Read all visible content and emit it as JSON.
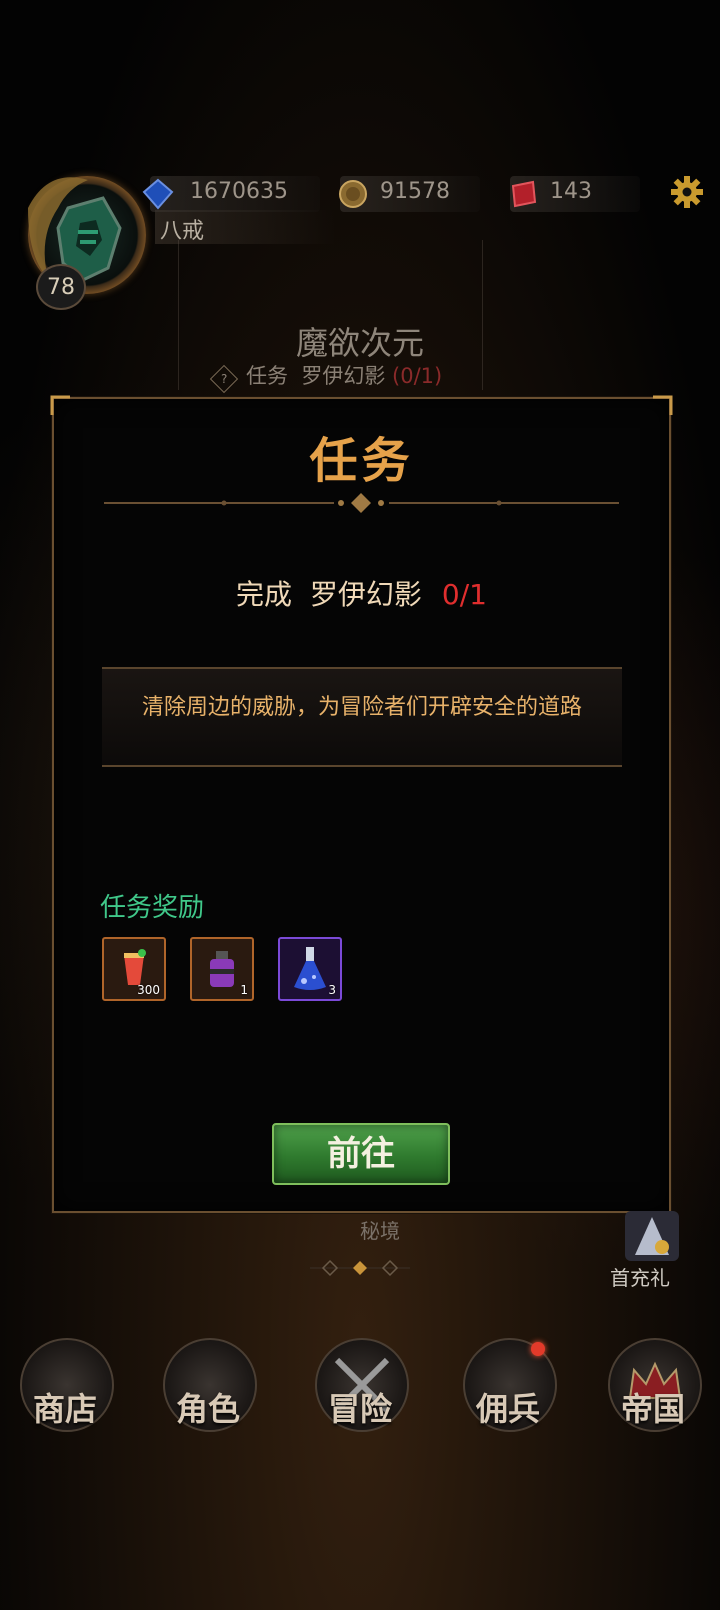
{
  "player": {
    "name": "八戒",
    "level": "78"
  },
  "resources": [
    {
      "name": "diamond-currency",
      "value": "1670635"
    },
    {
      "name": "gold-coin",
      "value": "91578"
    },
    {
      "name": "red-crystal",
      "value": "143"
    }
  ],
  "zone": {
    "title": "魔欲次元",
    "quest_prefix": "任务",
    "quest_target": "罗伊幻影",
    "quest_progress": "(0/1)",
    "hint_icon": "?"
  },
  "dialog": {
    "title": "任务",
    "objective_verb": "完成",
    "objective_target": "罗伊幻影",
    "objective_progress": "0/1",
    "description": "清除周边的威胁，为冒险者们开辟安全的道路",
    "reward_label": "任务奖励",
    "rewards": [
      {
        "icon": "cocktail-drink-icon",
        "qty": "300"
      },
      {
        "icon": "purple-jar-icon",
        "qty": "1"
      },
      {
        "icon": "blue-potion-flask-icon",
        "qty": "3"
      }
    ],
    "go_button": "前往"
  },
  "secret_realm_label": "秘境",
  "first_recharge_label": "首充礼",
  "nav": [
    {
      "label": "商店",
      "icon": "castle-shop-icon"
    },
    {
      "label": "角色",
      "icon": "character-icon"
    },
    {
      "label": "冒险",
      "icon": "crossed-swords-icon"
    },
    {
      "label": "佣兵",
      "icon": "mercenary-card-icon"
    },
    {
      "label": "帝国",
      "icon": "crown-icon"
    }
  ],
  "colors": {
    "title_gold": "#e6a24a",
    "progress_red": "#e02e2e",
    "reward_green": "#40c88a",
    "button_green": "#2f7a2e"
  }
}
